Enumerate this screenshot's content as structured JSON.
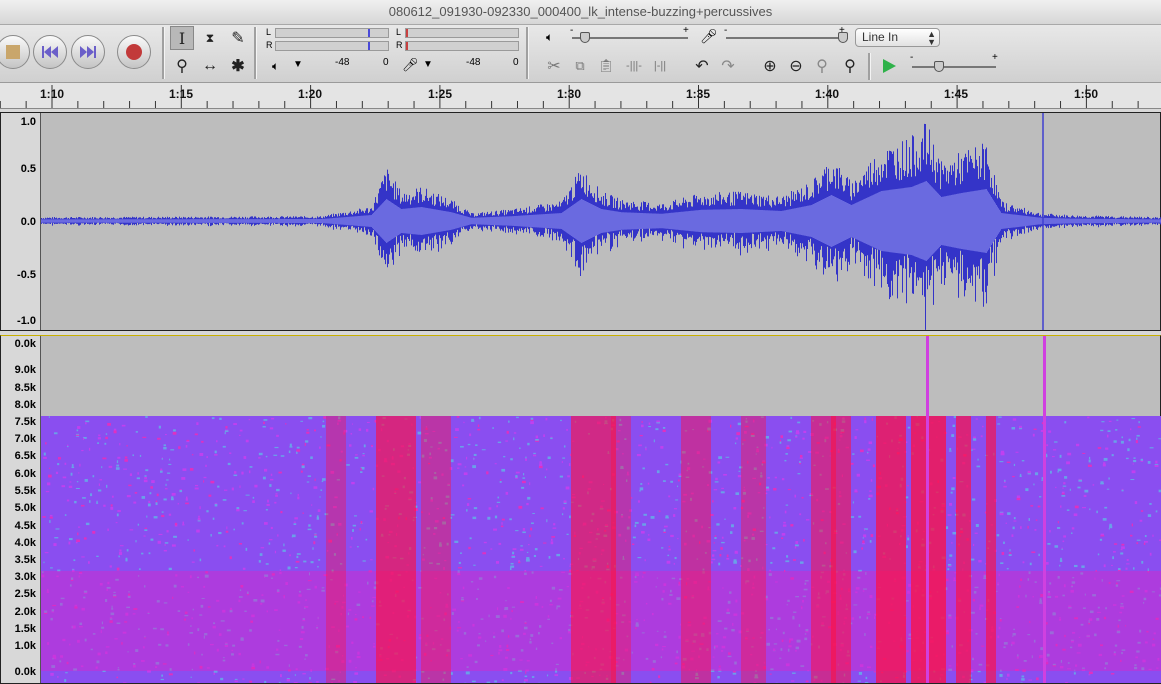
{
  "window": {
    "title": "080612_091930-092330_000400_lk_intense-buzzing+percussives"
  },
  "transport": {
    "buttons": [
      "stop",
      "skip-start",
      "skip-end",
      "record"
    ]
  },
  "tools": {
    "selected": "selection-tool"
  },
  "meters": {
    "out_l": "L",
    "out_r": "R",
    "in_l": "L",
    "in_r": "R",
    "out_scale": "-48",
    "out_zero": "0",
    "in_scale": "-48",
    "in_zero": "0"
  },
  "mixer": {
    "output_minus": "-",
    "output_plus": "+",
    "input_minus": "-",
    "input_plus": "+",
    "input_source": "Line In",
    "speed_minus": "-",
    "speed_plus": "+"
  },
  "ruler": {
    "ticks": [
      "1:10",
      "1:15",
      "1:20",
      "1:25",
      "1:30",
      "1:35",
      "1:40",
      "1:45",
      "1:50"
    ]
  },
  "waveform": {
    "scale": [
      "1.0",
      "0.5",
      "0.0",
      "-0.5",
      "-1.0"
    ],
    "color": "#3434c8"
  },
  "spectrogram": {
    "scale": [
      "0.0k",
      "9.0k",
      "8.5k",
      "8.0k",
      "7.5k",
      "7.0k",
      "6.5k",
      "6.0k",
      "5.5k",
      "5.0k",
      "4.5k",
      "4.0k",
      "3.5k",
      "3.0k",
      "2.5k",
      "2.0k",
      "1.5k",
      "1.0k",
      "0.0k"
    ],
    "colors": {
      "low": "#6aa0e8",
      "mid": "#c040f0",
      "high": "#ff1040"
    }
  }
}
